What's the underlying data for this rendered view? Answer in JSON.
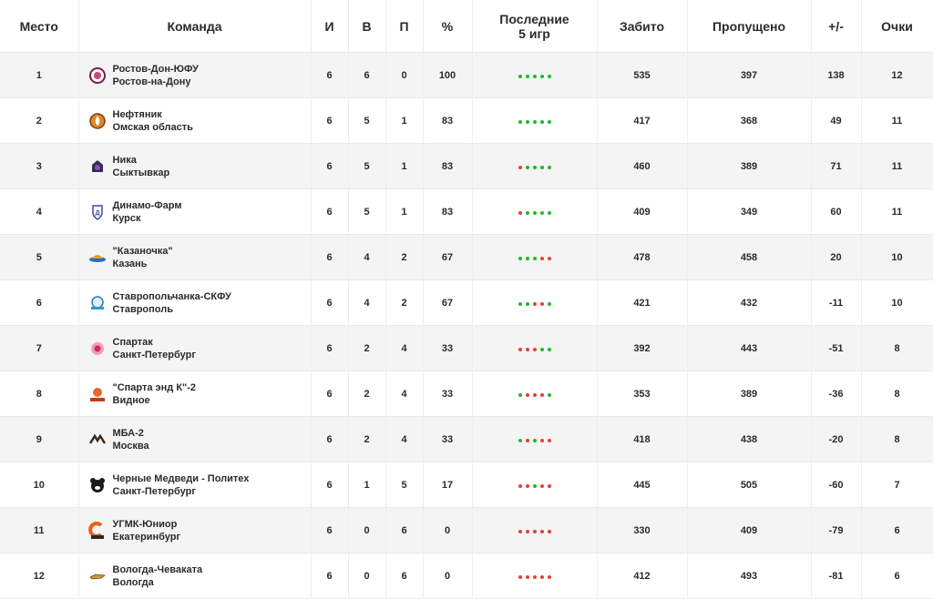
{
  "header": {
    "place": "Место",
    "team": "Команда",
    "games": "И",
    "wins": "В",
    "losses": "П",
    "pct": "%",
    "last5_line1": "Последние",
    "last5_line2": "5 игр",
    "scored": "Забито",
    "conceded": "Пропущено",
    "diff": "+/-",
    "points": "Очки"
  },
  "colors": {
    "win": "#20b82a",
    "loss": "#e0403a"
  },
  "rows": [
    {
      "place": "1",
      "team": "Ростов-Дон-ЮФУ",
      "city": "Ростов-на-Дону",
      "logo_icon": "rostov-don-logo-icon",
      "games": "6",
      "wins": "6",
      "losses": "0",
      "pct": "100",
      "last5": [
        "w",
        "w",
        "w",
        "w",
        "w"
      ],
      "scored": "535",
      "conceded": "397",
      "diff": "138",
      "points": "12"
    },
    {
      "place": "2",
      "team": "Нефтяник",
      "city": "Омская область",
      "logo_icon": "neftyanik-logo-icon",
      "games": "6",
      "wins": "5",
      "losses": "1",
      "pct": "83",
      "last5": [
        "w",
        "w",
        "w",
        "w",
        "w"
      ],
      "scored": "417",
      "conceded": "368",
      "diff": "49",
      "points": "11"
    },
    {
      "place": "3",
      "team": "Ника",
      "city": "Сыктывкар",
      "logo_icon": "nika-logo-icon",
      "games": "6",
      "wins": "5",
      "losses": "1",
      "pct": "83",
      "last5": [
        "l",
        "w",
        "w",
        "w",
        "w"
      ],
      "scored": "460",
      "conceded": "389",
      "diff": "71",
      "points": "11"
    },
    {
      "place": "4",
      "team": "Динамо-Фарм",
      "city": "Курск",
      "logo_icon": "dinamo-farm-logo-icon",
      "games": "6",
      "wins": "5",
      "losses": "1",
      "pct": "83",
      "last5": [
        "l",
        "w",
        "w",
        "w",
        "w"
      ],
      "scored": "409",
      "conceded": "349",
      "diff": "60",
      "points": "11"
    },
    {
      "place": "5",
      "team": "\"Казаночка\"",
      "city": "Казань",
      "logo_icon": "kazanochka-logo-icon",
      "games": "6",
      "wins": "4",
      "losses": "2",
      "pct": "67",
      "last5": [
        "w",
        "w",
        "w",
        "l",
        "l"
      ],
      "scored": "478",
      "conceded": "458",
      "diff": "20",
      "points": "10"
    },
    {
      "place": "6",
      "team": "Ставропольчанка-СКФУ",
      "city": "Ставрополь",
      "logo_icon": "stavropolchanka-logo-icon",
      "games": "6",
      "wins": "4",
      "losses": "2",
      "pct": "67",
      "last5": [
        "w",
        "w",
        "l",
        "l",
        "w"
      ],
      "scored": "421",
      "conceded": "432",
      "diff": "-11",
      "points": "10"
    },
    {
      "place": "7",
      "team": "Спартак",
      "city": "Санкт-Петербург",
      "logo_icon": "spartak-logo-icon",
      "games": "6",
      "wins": "2",
      "losses": "4",
      "pct": "33",
      "last5": [
        "l",
        "l",
        "l",
        "w",
        "w"
      ],
      "scored": "392",
      "conceded": "443",
      "diff": "-51",
      "points": "8"
    },
    {
      "place": "8",
      "team": "\"Спарта энд К\"-2",
      "city": "Видное",
      "logo_icon": "sparta-k-logo-icon",
      "games": "6",
      "wins": "2",
      "losses": "4",
      "pct": "33",
      "last5": [
        "w",
        "l",
        "l",
        "l",
        "w"
      ],
      "scored": "353",
      "conceded": "389",
      "diff": "-36",
      "points": "8"
    },
    {
      "place": "9",
      "team": "МБА-2",
      "city": "Москва",
      "logo_icon": "mba-logo-icon",
      "games": "6",
      "wins": "2",
      "losses": "4",
      "pct": "33",
      "last5": [
        "w",
        "l",
        "w",
        "l",
        "l"
      ],
      "scored": "418",
      "conceded": "438",
      "diff": "-20",
      "points": "8"
    },
    {
      "place": "10",
      "team": "Черные Медведи - Политех",
      "city": "Санкт-Петербург",
      "logo_icon": "black-bears-logo-icon",
      "games": "6",
      "wins": "1",
      "losses": "5",
      "pct": "17",
      "last5": [
        "l",
        "l",
        "w",
        "l",
        "l"
      ],
      "scored": "445",
      "conceded": "505",
      "diff": "-60",
      "points": "7"
    },
    {
      "place": "11",
      "team": "УГМК-Юниор",
      "city": "Екатеринбург",
      "logo_icon": "ugmk-logo-icon",
      "games": "6",
      "wins": "0",
      "losses": "6",
      "pct": "0",
      "last5": [
        "l",
        "l",
        "l",
        "l",
        "l"
      ],
      "scored": "330",
      "conceded": "409",
      "diff": "-79",
      "points": "6"
    },
    {
      "place": "12",
      "team": "Вологда-Чеваката",
      "city": "Вологда",
      "logo_icon": "vologda-logo-icon",
      "games": "6",
      "wins": "0",
      "losses": "6",
      "pct": "0",
      "last5": [
        "l",
        "l",
        "l",
        "l",
        "l"
      ],
      "scored": "412",
      "conceded": "493",
      "diff": "-81",
      "points": "6"
    }
  ]
}
